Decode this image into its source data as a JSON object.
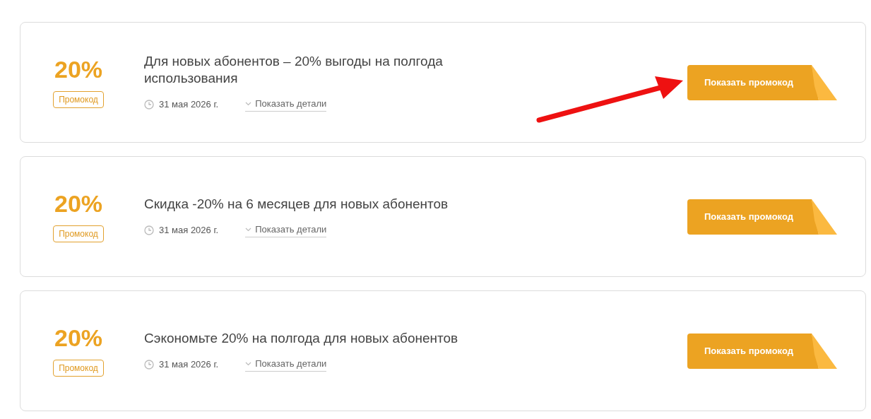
{
  "offers": [
    {
      "discount": "20%",
      "badge": "Промокод",
      "title": "Для новых абонентов – 20% выгоды на полгода использования",
      "date": "31 мая 2026 г.",
      "details_link": "Показать детали",
      "button": "Показать промокод",
      "highlighted": true
    },
    {
      "discount": "20%",
      "badge": "Промокод",
      "title": "Скидка -20% на 6 месяцев для новых абонентов",
      "date": "31 мая 2026 г.",
      "details_link": "Показать детали",
      "button": "Показать промокод",
      "highlighted": false
    },
    {
      "discount": "20%",
      "badge": "Промокод",
      "title": "Сэкономьте 20% на полгода для новых абонентов",
      "date": "31 мая 2026 г.",
      "details_link": "Показать детали",
      "button": "Показать промокод",
      "highlighted": false
    }
  ]
}
